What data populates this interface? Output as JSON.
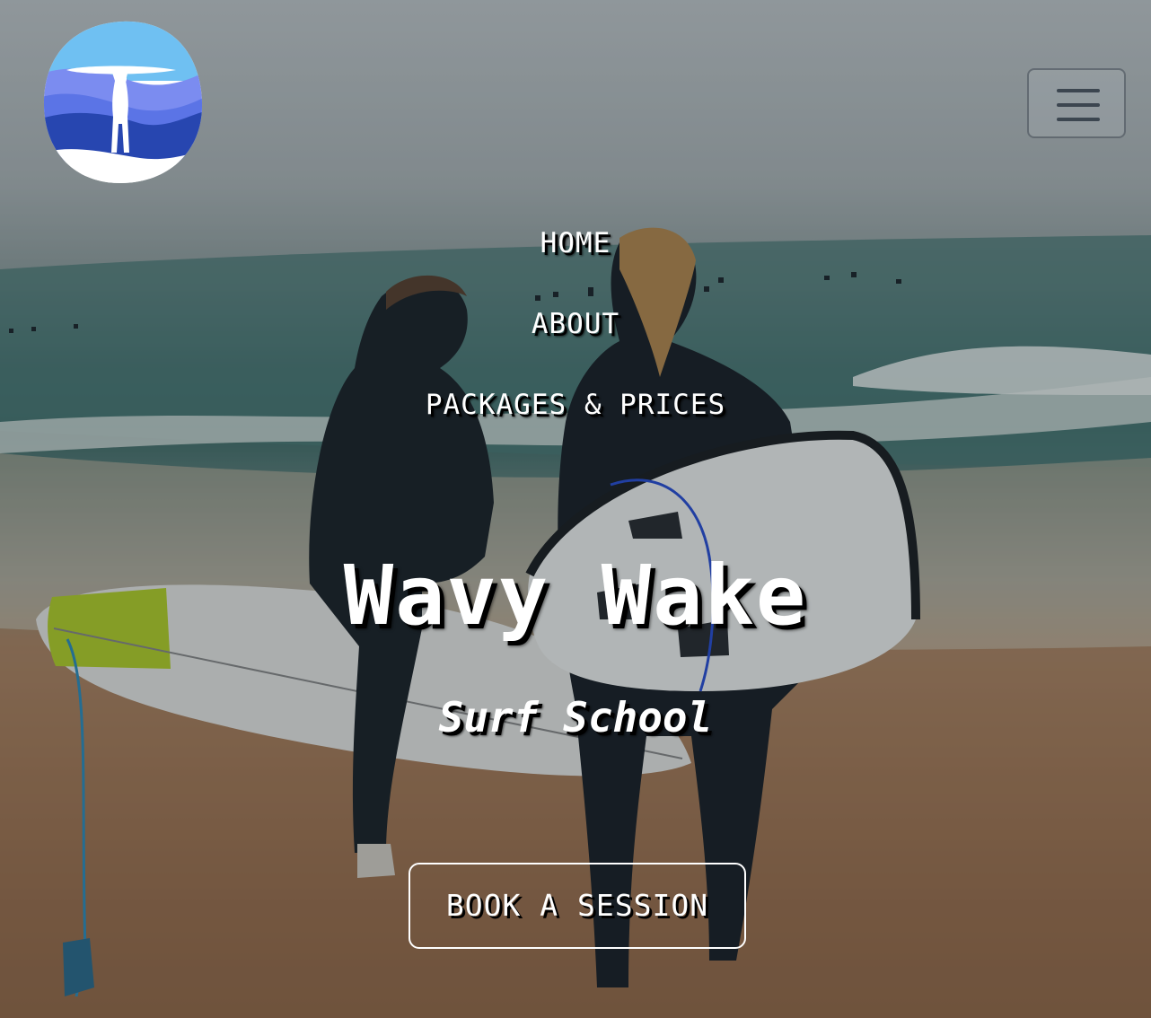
{
  "logo": {
    "alt": "Wavy Wake logo"
  },
  "menu_toggle": {
    "icon": "hamburger-menu-icon"
  },
  "nav": {
    "items": [
      {
        "label": "HOME"
      },
      {
        "label": "ABOUT"
      },
      {
        "label": "PACKAGES & PRICES"
      }
    ]
  },
  "hero": {
    "title": "Wavy Wake",
    "subtitle": "Surf School",
    "cta_label": "BOOK A SESSION"
  },
  "colors": {
    "logo_sky": "#6fc0f2",
    "logo_band_light": "#7b8cf0",
    "logo_band_mid": "#5b74e6",
    "logo_band_dark": "#2746b0",
    "text": "#ffffff",
    "text_shadow": "#000000"
  }
}
